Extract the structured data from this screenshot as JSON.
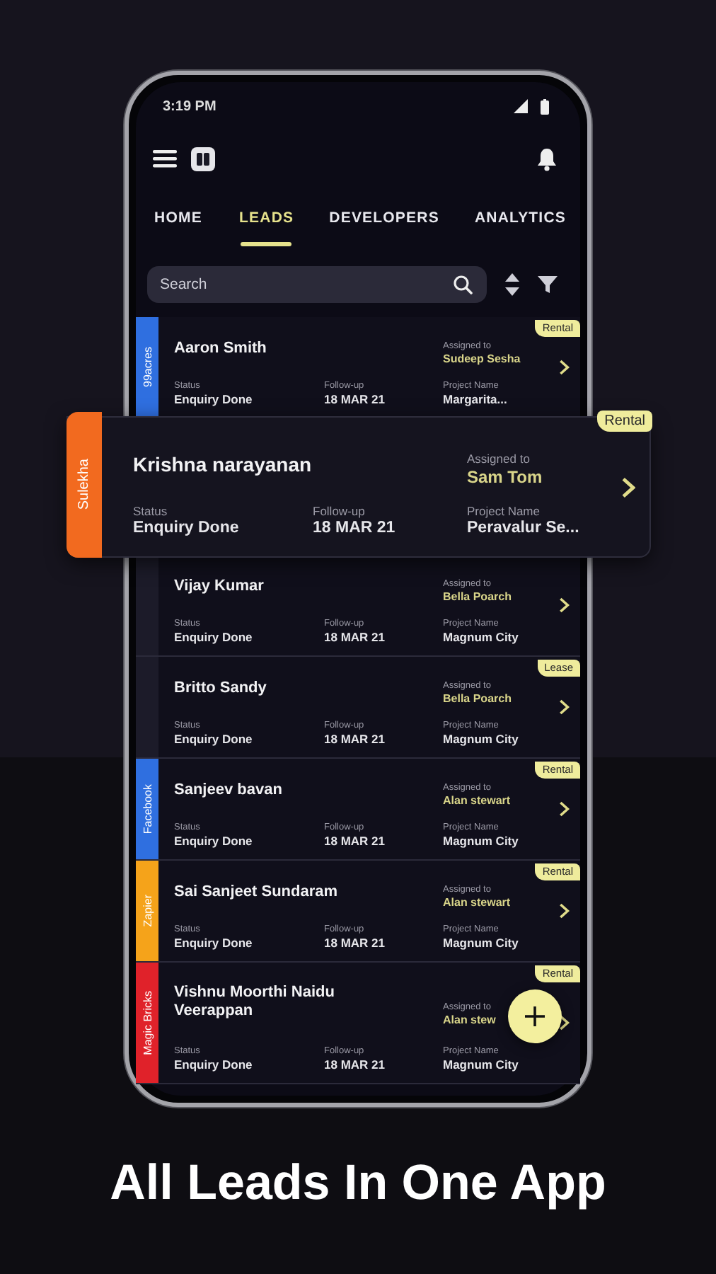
{
  "status_bar": {
    "time": "3:19 PM"
  },
  "tabs": [
    {
      "label": "HOME",
      "selected": false
    },
    {
      "label": "LEADS",
      "selected": true
    },
    {
      "label": "DEVELOPERS",
      "selected": false
    },
    {
      "label": "ANALYTICS",
      "selected": false
    }
  ],
  "search": {
    "placeholder": "Search"
  },
  "leads": [
    {
      "kind": "row",
      "source": "99acres",
      "color": "#2f6fe0",
      "name": "Aaron Smith",
      "tag": "Rental",
      "assigned_label": "Assigned to",
      "assigned_to": "Sudeep Sesha",
      "status_label": "Status",
      "status": "Enquiry Done",
      "followup_label": "Follow-up",
      "followup": "18 MAR 21",
      "project_label": "Project Name",
      "project": "Margarita..."
    },
    {
      "kind": "featured",
      "source": "Sulekha",
      "color": "#f26a1f",
      "name": "Krishna narayanan",
      "tag": "Rental",
      "assigned_label": "Assigned to",
      "assigned_to": "Sam Tom",
      "status_label": "Status",
      "status": "Enquiry Done",
      "followup_label": "Follow-up",
      "followup": "18 MAR 21",
      "project_label": "Project Name",
      "project": "Peravalur Se..."
    },
    {
      "kind": "row",
      "color": "#1c1b29",
      "name": "Vijay Kumar",
      "assigned_label": "Assigned to",
      "assigned_to": "Bella Poarch",
      "status_label": "Status",
      "status": "Enquiry Done",
      "followup_label": "Follow-up",
      "followup": "18 MAR 21",
      "project_label": "Project Name",
      "project": "Magnum City"
    },
    {
      "kind": "row",
      "color": "#1c1b29",
      "name": "Britto Sandy",
      "tag": "Lease",
      "assigned_label": "Assigned to",
      "assigned_to": "Bella Poarch",
      "status_label": "Status",
      "status": "Enquiry Done",
      "followup_label": "Follow-up",
      "followup": "18 MAR 21",
      "project_label": "Project Name",
      "project": "Magnum City"
    },
    {
      "kind": "row",
      "source": "Facebook",
      "color": "#2f6fe0",
      "name": "Sanjeev bavan",
      "tag": "Rental",
      "assigned_label": "Assigned to",
      "assigned_to": "Alan stewart",
      "status_label": "Status",
      "status": "Enquiry Done",
      "followup_label": "Follow-up",
      "followup": "18 MAR 21",
      "project_label": "Project Name",
      "project": "Magnum City"
    },
    {
      "kind": "row",
      "source": "Zapier",
      "color": "#f5a31a",
      "name": "Sai Sanjeet Sundaram",
      "tag": "Rental",
      "assigned_label": "Assigned to",
      "assigned_to": "Alan stewart",
      "status_label": "Status",
      "status": "Enquiry Done",
      "followup_label": "Follow-up",
      "followup": "18 MAR 21",
      "project_label": "Project Name",
      "project": "Magnum City"
    },
    {
      "kind": "row",
      "source": "Magic Bricks",
      "color": "#e0222a",
      "name": "Vishnu Moorthi Naidu Veerappan",
      "tag": "Rental",
      "assigned_label": "Assigned to",
      "assigned_to": "Alan stew",
      "status_label": "Status",
      "status": "Enquiry Done",
      "followup_label": "Follow-up",
      "followup": "18 MAR 21",
      "project_label": "Project Name",
      "project": "Magnum City"
    }
  ],
  "caption": "All Leads In One App"
}
